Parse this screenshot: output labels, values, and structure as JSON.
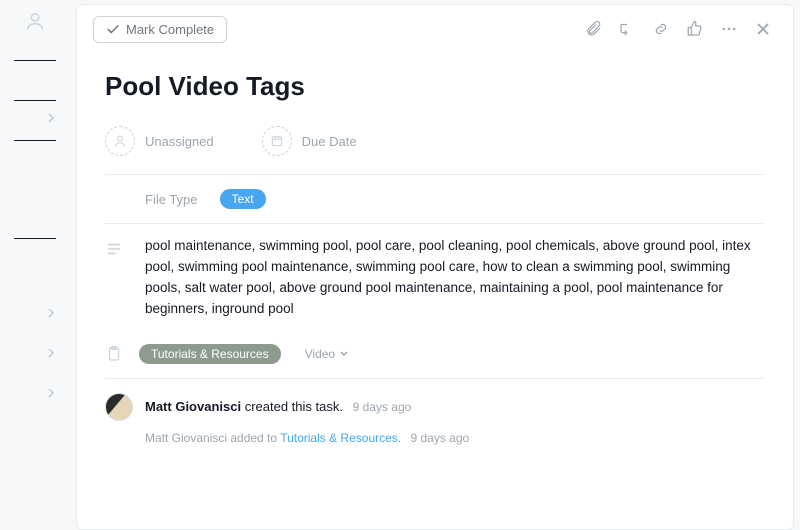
{
  "toolbar": {
    "mark_complete_label": "Mark Complete"
  },
  "title": "Pool Video Tags",
  "meta": {
    "assignee_label": "Unassigned",
    "due_label": "Due Date"
  },
  "custom_field": {
    "label": "File Type",
    "value": "Text"
  },
  "description": "pool maintenance, swimming pool, pool care, pool cleaning, pool chemicals, above ground pool, intex pool, swimming pool maintenance, swimming pool care, how to clean a swimming pool, swimming pools, salt water pool, above ground pool maintenance, maintaining a pool, pool maintenance for beginners, inground pool",
  "tags": {
    "project": "Tutorials & Resources",
    "section": "Video"
  },
  "activity": {
    "creator": "Matt Giovanisci",
    "created_suffix": " created this task.",
    "created_ago": "9 days ago",
    "added_prefix": "Matt Giovanisci added to ",
    "added_project": "Tutorials & Resources",
    "added_suffix": ".",
    "added_ago": "9 days ago"
  }
}
